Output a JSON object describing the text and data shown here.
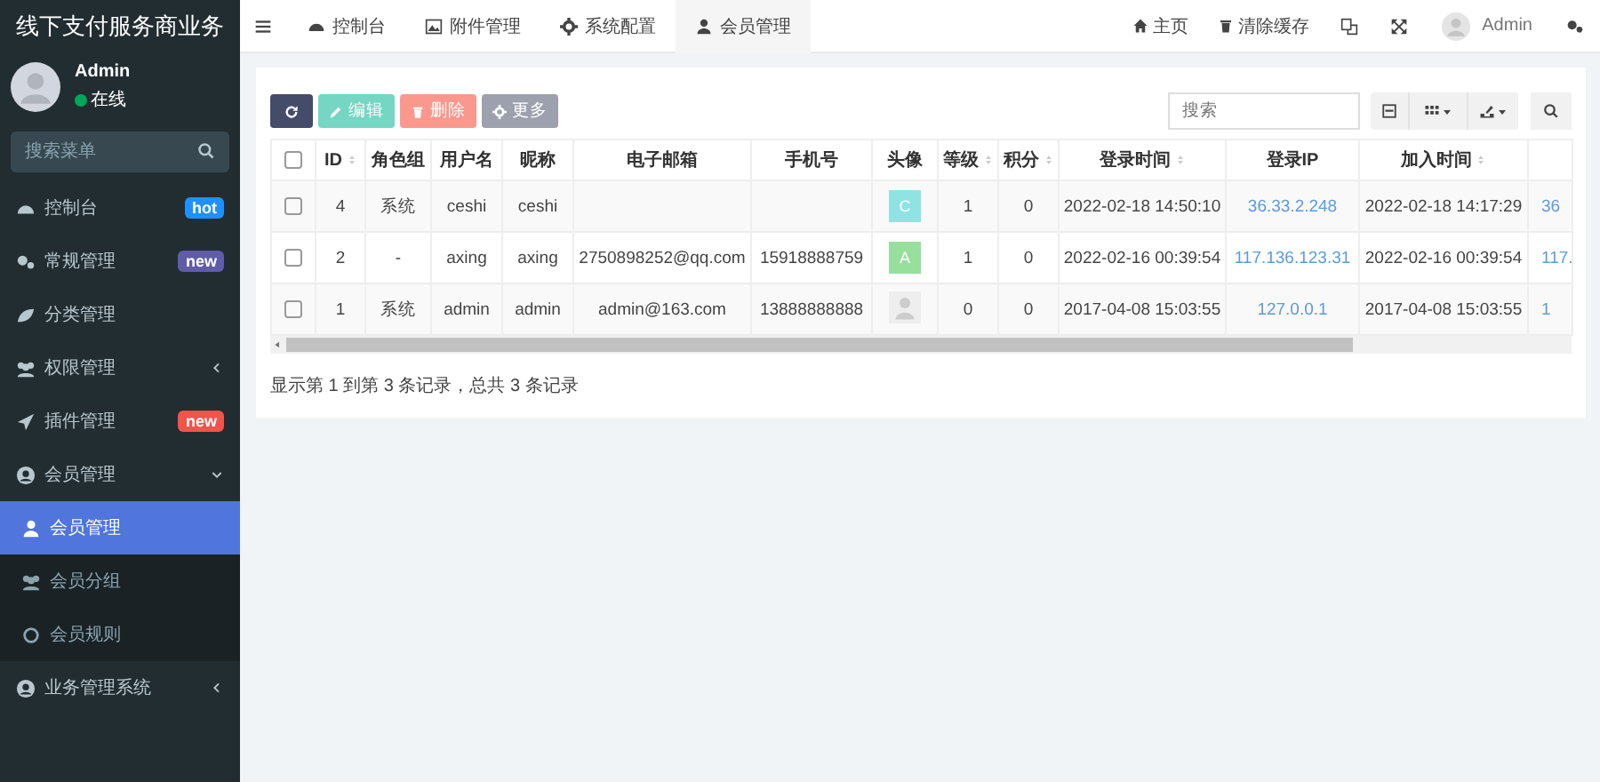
{
  "sidebar": {
    "brand": "线下支付服务商业务",
    "user": {
      "name": "Admin",
      "status": "在线",
      "online": true
    },
    "search": {
      "placeholder": "搜索菜单"
    },
    "items": [
      {
        "label": "控制台",
        "selected": false,
        "badge": {
          "text": "hot",
          "color": "#1e90ff"
        }
      },
      {
        "label": "常规管理",
        "selected": false,
        "badge": {
          "text": "new",
          "color": "#605ca8"
        }
      },
      {
        "label": "分类管理",
        "selected": false
      },
      {
        "label": "权限管理",
        "selected": false,
        "expanded": false
      },
      {
        "label": "插件管理",
        "selected": false,
        "badge": {
          "text": "new",
          "color": "#f0544a"
        }
      },
      {
        "label": "会员管理",
        "selected": false,
        "expanded": true,
        "children": [
          {
            "label": "会员管理",
            "selected": true
          },
          {
            "label": "会员分组",
            "selected": false
          },
          {
            "label": "会员规则",
            "selected": false
          }
        ]
      },
      {
        "label": "业务管理系统",
        "selected": false,
        "expanded": false
      }
    ]
  },
  "header": {
    "tabs": [
      {
        "label": "控制台",
        "selected": false
      },
      {
        "label": "附件管理",
        "selected": false
      },
      {
        "label": "系统配置",
        "selected": false
      },
      {
        "label": "会员管理",
        "selected": true
      }
    ],
    "links": [
      "主页",
      "清除缓存"
    ],
    "user": "Admin"
  },
  "toolbar": {
    "buttons": [
      {
        "kind": "refresh",
        "disabled": false
      },
      {
        "kind": "edit",
        "label": "编辑",
        "disabled": true
      },
      {
        "kind": "delete",
        "label": "删除",
        "disabled": true
      },
      {
        "kind": "more",
        "label": "更多",
        "disabled": true
      }
    ],
    "search": {
      "placeholder": "搜索"
    }
  },
  "table": {
    "select_all": {
      "checked": false
    },
    "columns": [
      {
        "label": "ID",
        "sortable": true
      },
      {
        "label": "角色组",
        "sortable": false
      },
      {
        "label": "用户名",
        "sortable": false
      },
      {
        "label": "昵称",
        "sortable": false
      },
      {
        "label": "电子邮箱",
        "sortable": false
      },
      {
        "label": "手机号",
        "sortable": false
      },
      {
        "label": "头像",
        "sortable": false
      },
      {
        "label": "等级",
        "sortable": true
      },
      {
        "label": "积分",
        "sortable": true
      },
      {
        "label": "登录时间",
        "sortable": true
      },
      {
        "label": "登录IP",
        "sortable": false
      },
      {
        "label": "加入时间",
        "sortable": true
      }
    ],
    "rows": [
      {
        "checked": false,
        "id": "4",
        "role": "系统",
        "username": "ceshi",
        "nickname": "ceshi",
        "avatar": {
          "kind": "letter",
          "text": "C",
          "color": "#8fe3e3"
        },
        "grade": "1",
        "points": "0",
        "login_time": "2022-02-18 14:50:10",
        "login_ip": "36.33.2.248",
        "join_time": "2022-02-18 14:17:29",
        "column_14": "36"
      },
      {
        "checked": false,
        "id": "2",
        "role": "-",
        "username": "axing",
        "nickname": "axing",
        "email": "2750898252@qq.com",
        "phone": "15918888759",
        "avatar": {
          "kind": "letter",
          "text": "A",
          "color": "#97df9c"
        },
        "grade": "1",
        "points": "0",
        "login_time": "2022-02-16 00:39:54",
        "login_ip": "117.136.123.31",
        "join_time": "2022-02-16 00:39:54",
        "column_14": "117."
      },
      {
        "checked": false,
        "id": "1",
        "role": "系统",
        "username": "admin",
        "nickname": "admin",
        "email": "admin@163.com",
        "phone": "13888888888",
        "avatar": {
          "kind": "default"
        },
        "grade": "0",
        "points": "0",
        "login_time": "2017-04-08 15:03:55",
        "login_ip": "127.0.0.1",
        "join_time": "2017-04-08 15:03:55",
        "column_14": "1"
      }
    ],
    "pagination": "显示第 1 到第 3 条记录，总共 3 条记录"
  }
}
